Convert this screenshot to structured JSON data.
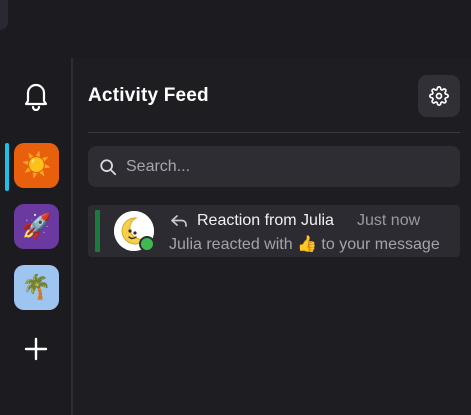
{
  "rail": {
    "items": [
      {
        "name": "sun",
        "emoji": "☀️",
        "bg": "#e8600c",
        "active": true
      },
      {
        "name": "rocket",
        "emoji": "🚀",
        "bg": "#6b3aa0",
        "active": false
      },
      {
        "name": "palm",
        "emoji": "🌴",
        "bg": "#9ec5f0",
        "active": false
      }
    ],
    "active_indicator_color": "#1fc0e8",
    "add_icon": "plus-icon",
    "notifications_icon": "bell-icon"
  },
  "header": {
    "title": "Activity Feed",
    "settings_icon": "gear-icon"
  },
  "search": {
    "placeholder": "Search...",
    "value": ""
  },
  "notifications": [
    {
      "type_icon": "reply-icon",
      "title": "Reaction from Julia",
      "time": "Just now",
      "preview": "Julia reacted with 👍 to your message",
      "unread_bar_color": "#1b7a3e",
      "status": "online"
    }
  ]
}
